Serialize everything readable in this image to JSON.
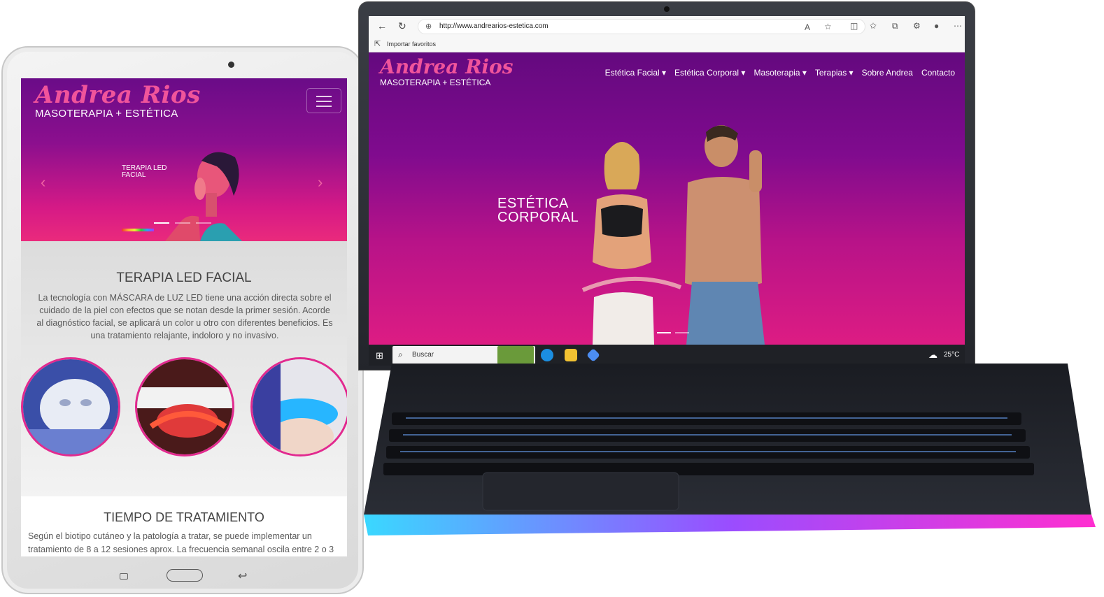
{
  "colors": {
    "accent": "#e22a8f",
    "logo_pink": "#f0549b",
    "hero_top": "#64097f",
    "hero_bottom": "#dd1c83"
  },
  "tablet": {
    "brand": {
      "script": "Andrea Rios",
      "subtitle": "MASOTERAPIA + ESTÉTICA"
    },
    "menu_icon": "hamburger-icon",
    "hero": {
      "slide_text": "TERAPIA LED FACIAL",
      "prev_icon": "chevron-left-icon",
      "next_icon": "chevron-right-icon"
    },
    "section1": {
      "title": "TERAPIA LED FACIAL",
      "body": "La tecnología con MÁSCARA de LUZ LED tiene una acción directa sobre el cuidado de la piel con efectos que se notan desde la primer sesión. Acorde al diagnóstico facial, se aplicará un color u otro con diferentes beneficios. Es una tratamiento relajante, indoloro y no invasivo."
    },
    "section2": {
      "title": "TIEMPO DE TRATAMIENTO",
      "body": "Según el biotipo cutáneo y la patología a tratar, se puede implementar un tratamiento de 8 a 12 sesiones aprox. La frecuencia semanal oscila entre 2 o 3"
    }
  },
  "laptop": {
    "browser": {
      "url": "http://www.andrearios-estetica.com",
      "favorites_label": "Importar favoritos"
    },
    "site": {
      "brand": {
        "script": "Andrea Rios",
        "subtitle": "MASOTERAPIA + ESTÉTICA"
      },
      "menu": [
        "Estética Facial ▾",
        "Estética Corporal ▾",
        "Masoterapia ▾",
        "Terapias ▾",
        "Sobre Andrea",
        "Contacto"
      ],
      "hero_title_line1": "ESTÉTICA",
      "hero_title_line2": "CORPORAL"
    },
    "taskbar": {
      "search_placeholder": "Buscar",
      "temperature": "25°C"
    }
  }
}
